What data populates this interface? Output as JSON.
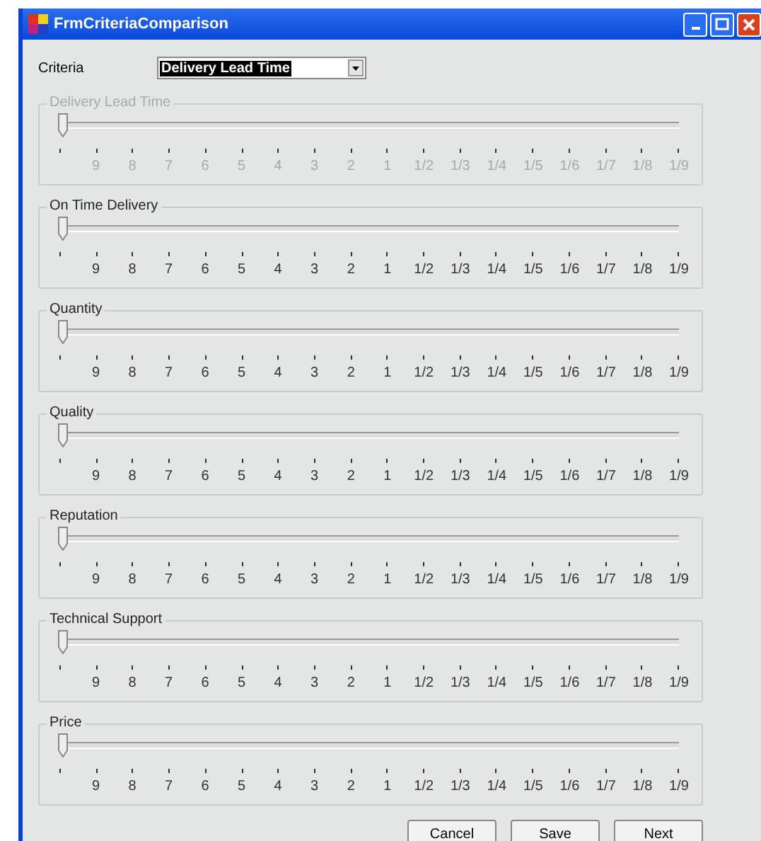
{
  "window": {
    "title": "FrmCriteriaComparison"
  },
  "criteria": {
    "label": "Criteria",
    "value": "Delivery Lead Time"
  },
  "groups": [
    {
      "label": "Delivery Lead Time",
      "disabled": true,
      "level": 0,
      "ticks": [
        "9",
        "8",
        "7",
        "6",
        "5",
        "4",
        "3",
        "2",
        "1",
        "1/2",
        "1/3",
        "1/4",
        "1/5",
        "1/6",
        "1/7",
        "1/8",
        "1/9"
      ]
    },
    {
      "label": "On Time Delivery",
      "disabled": false,
      "level": 0,
      "ticks": [
        "9",
        "8",
        "7",
        "6",
        "5",
        "4",
        "3",
        "2",
        "1",
        "1/2",
        "1/3",
        "1/4",
        "1/5",
        "1/6",
        "1/7",
        "1/8",
        "1/9"
      ]
    },
    {
      "label": "Quantity",
      "disabled": false,
      "level": 0,
      "ticks": [
        "9",
        "8",
        "7",
        "6",
        "5",
        "4",
        "3",
        "2",
        "1",
        "1/2",
        "1/3",
        "1/4",
        "1/5",
        "1/6",
        "1/7",
        "1/8",
        "1/9"
      ]
    },
    {
      "label": "Quality",
      "disabled": false,
      "level": 0,
      "ticks": [
        "9",
        "8",
        "7",
        "6",
        "5",
        "4",
        "3",
        "2",
        "1",
        "1/2",
        "1/3",
        "1/4",
        "1/5",
        "1/6",
        "1/7",
        "1/8",
        "1/9"
      ]
    },
    {
      "label": "Reputation",
      "disabled": false,
      "level": 0,
      "ticks": [
        "9",
        "8",
        "7",
        "6",
        "5",
        "4",
        "3",
        "2",
        "1",
        "1/2",
        "1/3",
        "1/4",
        "1/5",
        "1/6",
        "1/7",
        "1/8",
        "1/9"
      ]
    },
    {
      "label": "Technical Support",
      "disabled": false,
      "level": 0,
      "ticks": [
        "9",
        "8",
        "7",
        "6",
        "5",
        "4",
        "3",
        "2",
        "1",
        "1/2",
        "1/3",
        "1/4",
        "1/5",
        "1/6",
        "1/7",
        "1/8",
        "1/9"
      ]
    },
    {
      "label": "Price",
      "disabled": false,
      "level": 0,
      "ticks": [
        "9",
        "8",
        "7",
        "6",
        "5",
        "4",
        "3",
        "2",
        "1",
        "1/2",
        "1/3",
        "1/4",
        "1/5",
        "1/6",
        "1/7",
        "1/8",
        "1/9"
      ]
    }
  ],
  "buttons": [
    "Cancel",
    "Save",
    "Next"
  ]
}
